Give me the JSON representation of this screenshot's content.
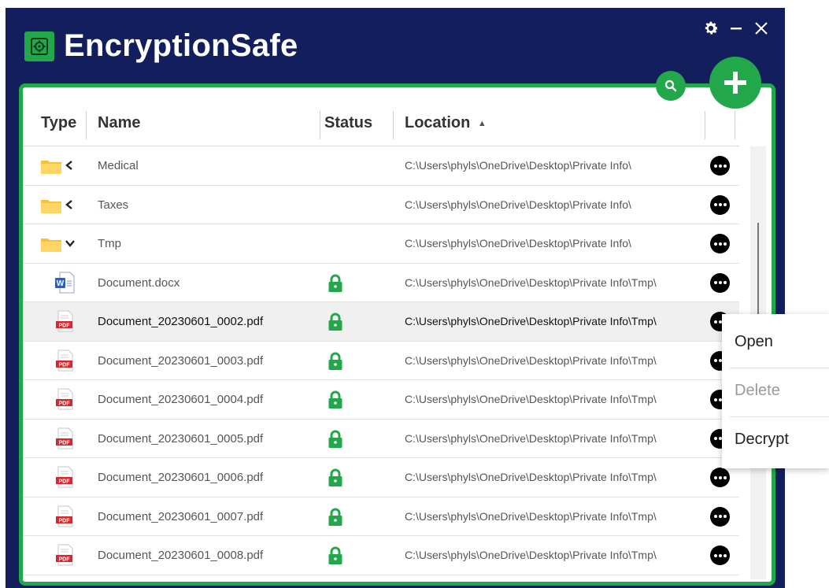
{
  "app": {
    "title": "EncryptionSafe"
  },
  "window_controls": [
    "settings-icon",
    "minimize-icon",
    "close-icon"
  ],
  "colors": {
    "background": "#121f5c",
    "accent": "#22a84a",
    "panel": "#ffffff"
  },
  "columns": {
    "type": "Type",
    "name": "Name",
    "status": "Status",
    "location": "Location",
    "sort_indicator": "▲"
  },
  "rows": [
    {
      "icon": "folder-icon",
      "expand": "collapsed",
      "name": "Medical",
      "locked": false,
      "location": "C:\\Users\\phyls\\OneDrive\\Desktop\\Private Info\\"
    },
    {
      "icon": "folder-icon",
      "expand": "collapsed",
      "name": "Taxes",
      "locked": false,
      "location": "C:\\Users\\phyls\\OneDrive\\Desktop\\Private Info\\"
    },
    {
      "icon": "folder-icon",
      "expand": "expanded",
      "name": "Tmp",
      "locked": false,
      "location": "C:\\Users\\phyls\\OneDrive\\Desktop\\Private Info\\"
    },
    {
      "icon": "word-doc-icon",
      "name": "Document.docx",
      "locked": true,
      "location": "C:\\Users\\phyls\\OneDrive\\Desktop\\Private Info\\Tmp\\"
    },
    {
      "icon": "pdf-icon",
      "name": "Document_20230601_0002.pdf",
      "locked": true,
      "selected": true,
      "location": "C:\\Users\\phyls\\OneDrive\\Desktop\\Private Info\\Tmp\\"
    },
    {
      "icon": "pdf-icon",
      "name": "Document_20230601_0003.pdf",
      "locked": true,
      "location": "C:\\Users\\phyls\\OneDrive\\Desktop\\Private Info\\Tmp\\"
    },
    {
      "icon": "pdf-icon",
      "name": "Document_20230601_0004.pdf",
      "locked": true,
      "location": "C:\\Users\\phyls\\OneDrive\\Desktop\\Private Info\\Tmp\\"
    },
    {
      "icon": "pdf-icon",
      "name": "Document_20230601_0005.pdf",
      "locked": true,
      "location": "C:\\Users\\phyls\\OneDrive\\Desktop\\Private Info\\Tmp\\"
    },
    {
      "icon": "pdf-icon",
      "name": "Document_20230601_0006.pdf",
      "locked": true,
      "location": "C:\\Users\\phyls\\OneDrive\\Desktop\\Private Info\\Tmp\\"
    },
    {
      "icon": "pdf-icon",
      "name": "Document_20230601_0007.pdf",
      "locked": true,
      "location": "C:\\Users\\phyls\\OneDrive\\Desktop\\Private Info\\Tmp\\"
    },
    {
      "icon": "pdf-icon",
      "name": "Document_20230601_0008.pdf",
      "locked": true,
      "location": "C:\\Users\\phyls\\OneDrive\\Desktop\\Private Info\\Tmp\\"
    }
  ],
  "context_menu": {
    "items": [
      {
        "label": "Open",
        "enabled": true
      },
      {
        "label": "Delete",
        "enabled": false
      },
      {
        "label": "Decrypt",
        "enabled": true
      }
    ]
  }
}
